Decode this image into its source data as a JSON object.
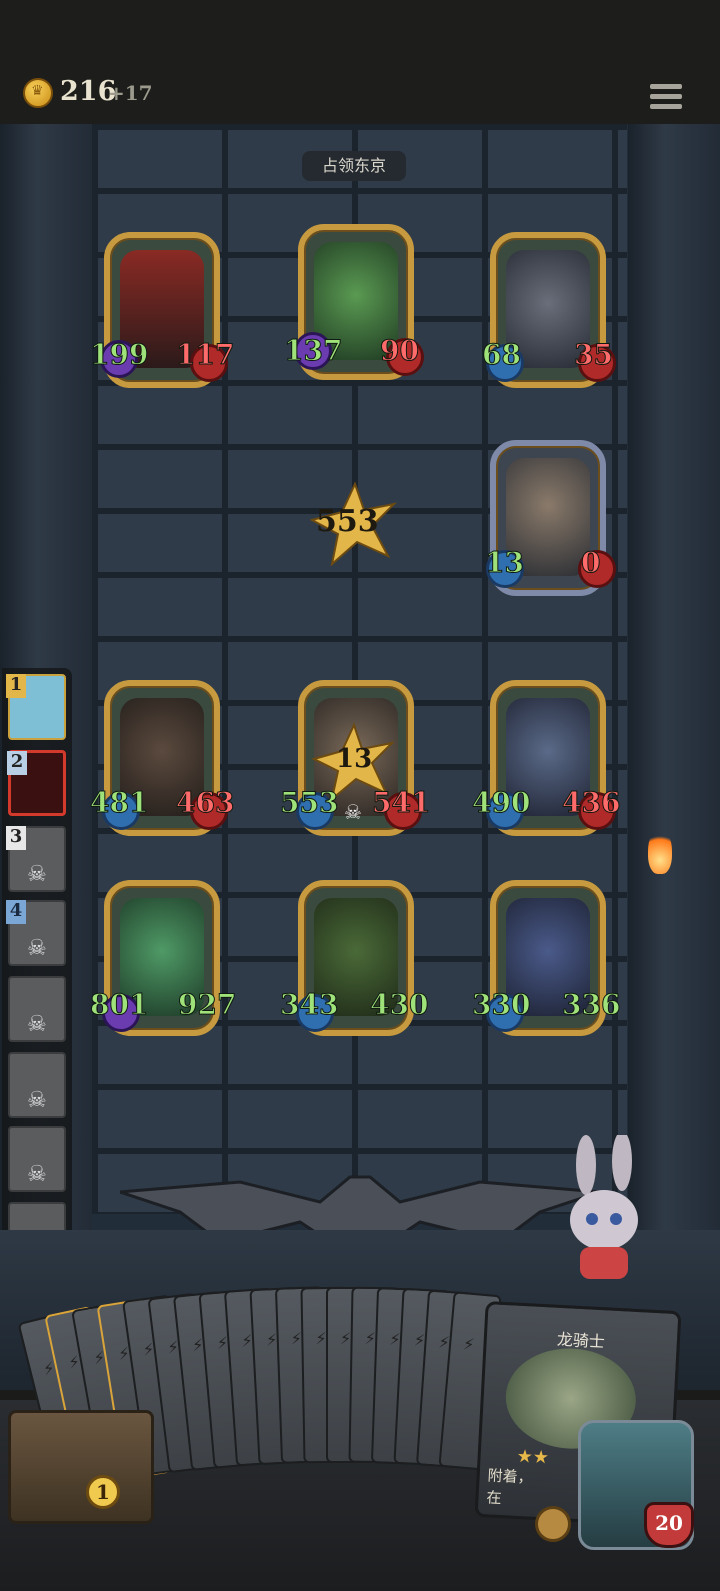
{
  "header": {
    "gold": "216",
    "gold_increment": "+17",
    "coin_icon": "crown-coin-icon",
    "menu_icon": "hamburger-menu-icon"
  },
  "level": {
    "title": "占领东京"
  },
  "enemy": {
    "cards": [
      {
        "name": "hooded-assassin",
        "atk": "199",
        "hp": "117",
        "hp_color": "#ff6b6b"
      },
      {
        "name": "cactus-monster",
        "atk": "137",
        "hp": "90",
        "hp_color": "#ff6b6b"
      },
      {
        "name": "sphynx-cat-pirate",
        "atk": "68",
        "hp": "35",
        "hp_color": "#ff6b6b"
      },
      {
        "name": "bearded-warrior",
        "atk": "13",
        "hp": "0",
        "hp_color": "#ff6b6b"
      }
    ],
    "total": "553"
  },
  "player": {
    "cards": [
      {
        "name": "stone-golem",
        "atk": "481",
        "hp": "463",
        "hp_color": "#ff6b6b"
      },
      {
        "name": "witch-mage",
        "atk": "553",
        "hp": "541",
        "hp_color": "#ff6b6b",
        "damage": "13"
      },
      {
        "name": "armored-knight",
        "atk": "490",
        "hp": "436",
        "hp_color": "#ff6b6b"
      },
      {
        "name": "forest-fairy",
        "atk": "801",
        "hp": "927",
        "hp_color": "#9fe27a"
      },
      {
        "name": "goblin-shaman",
        "atk": "343",
        "hp": "430",
        "hp_color": "#9fe27a"
      },
      {
        "name": "elf-sorceress",
        "atk": "330",
        "hp": "336",
        "hp_color": "#9fe27a"
      }
    ]
  },
  "turn_order": [
    {
      "num": "1",
      "state": "active"
    },
    {
      "num": "2",
      "state": "current"
    },
    {
      "num": "3",
      "state": "dead"
    },
    {
      "num": "4",
      "state": "dead"
    },
    {
      "num": "",
      "state": "dead"
    },
    {
      "num": "",
      "state": "dead"
    },
    {
      "num": "",
      "state": "dead"
    },
    {
      "num": "",
      "state": "dead"
    }
  ],
  "hand": {
    "featured_card_name": "龙骑士",
    "featured_card_desc": "附着，",
    "featured_card_desc2": "在"
  },
  "chest": {
    "count": "1"
  },
  "hero": {
    "hp": "20"
  }
}
